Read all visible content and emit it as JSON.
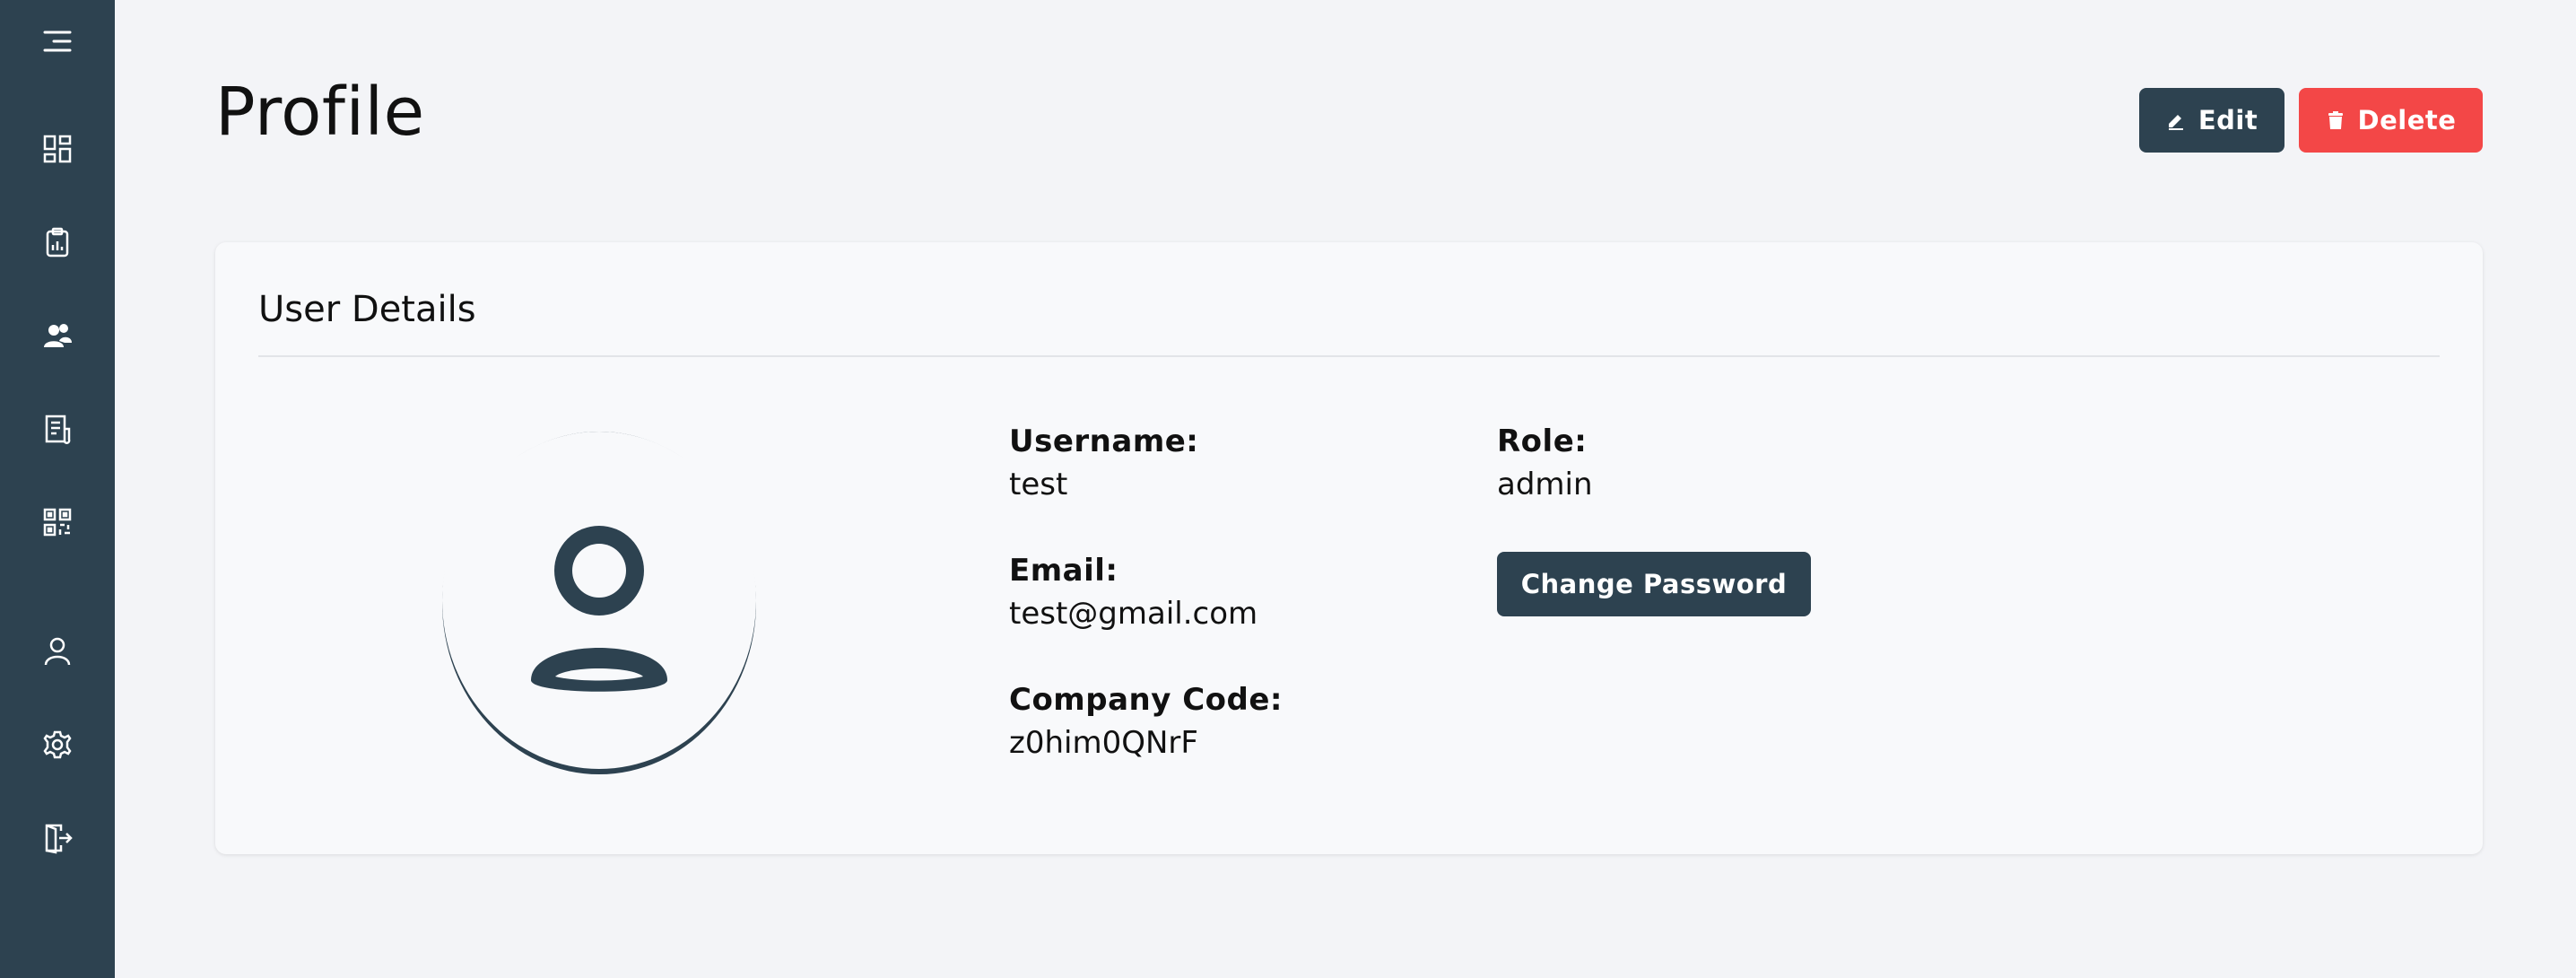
{
  "colors": {
    "sidebar_bg": "#2d4250",
    "primary": "#2d4250",
    "danger": "#f34747",
    "page_bg": "#f3f4f7"
  },
  "sidebar": {
    "items": [
      {
        "icon": "menu-icon"
      },
      {
        "icon": "dashboard-icon"
      },
      {
        "icon": "clipboard-chart-icon"
      },
      {
        "icon": "users-icon"
      },
      {
        "icon": "document-icon"
      },
      {
        "icon": "qr-code-icon"
      },
      {
        "icon": "user-icon"
      },
      {
        "icon": "gear-icon"
      },
      {
        "icon": "logout-icon"
      }
    ]
  },
  "header": {
    "title": "Profile",
    "edit_label": "Edit",
    "delete_label": "Delete"
  },
  "card": {
    "title": "User Details",
    "avatar_icon": "user-avatar-icon",
    "fields": {
      "username_label": "Username:",
      "username_value": "test",
      "email_label": "Email:",
      "email_value": "test@gmail.com",
      "company_label": "Company Code:",
      "company_value": "z0him0QNrF",
      "role_label": "Role:",
      "role_value": "admin"
    },
    "change_password_label": "Change Password"
  }
}
